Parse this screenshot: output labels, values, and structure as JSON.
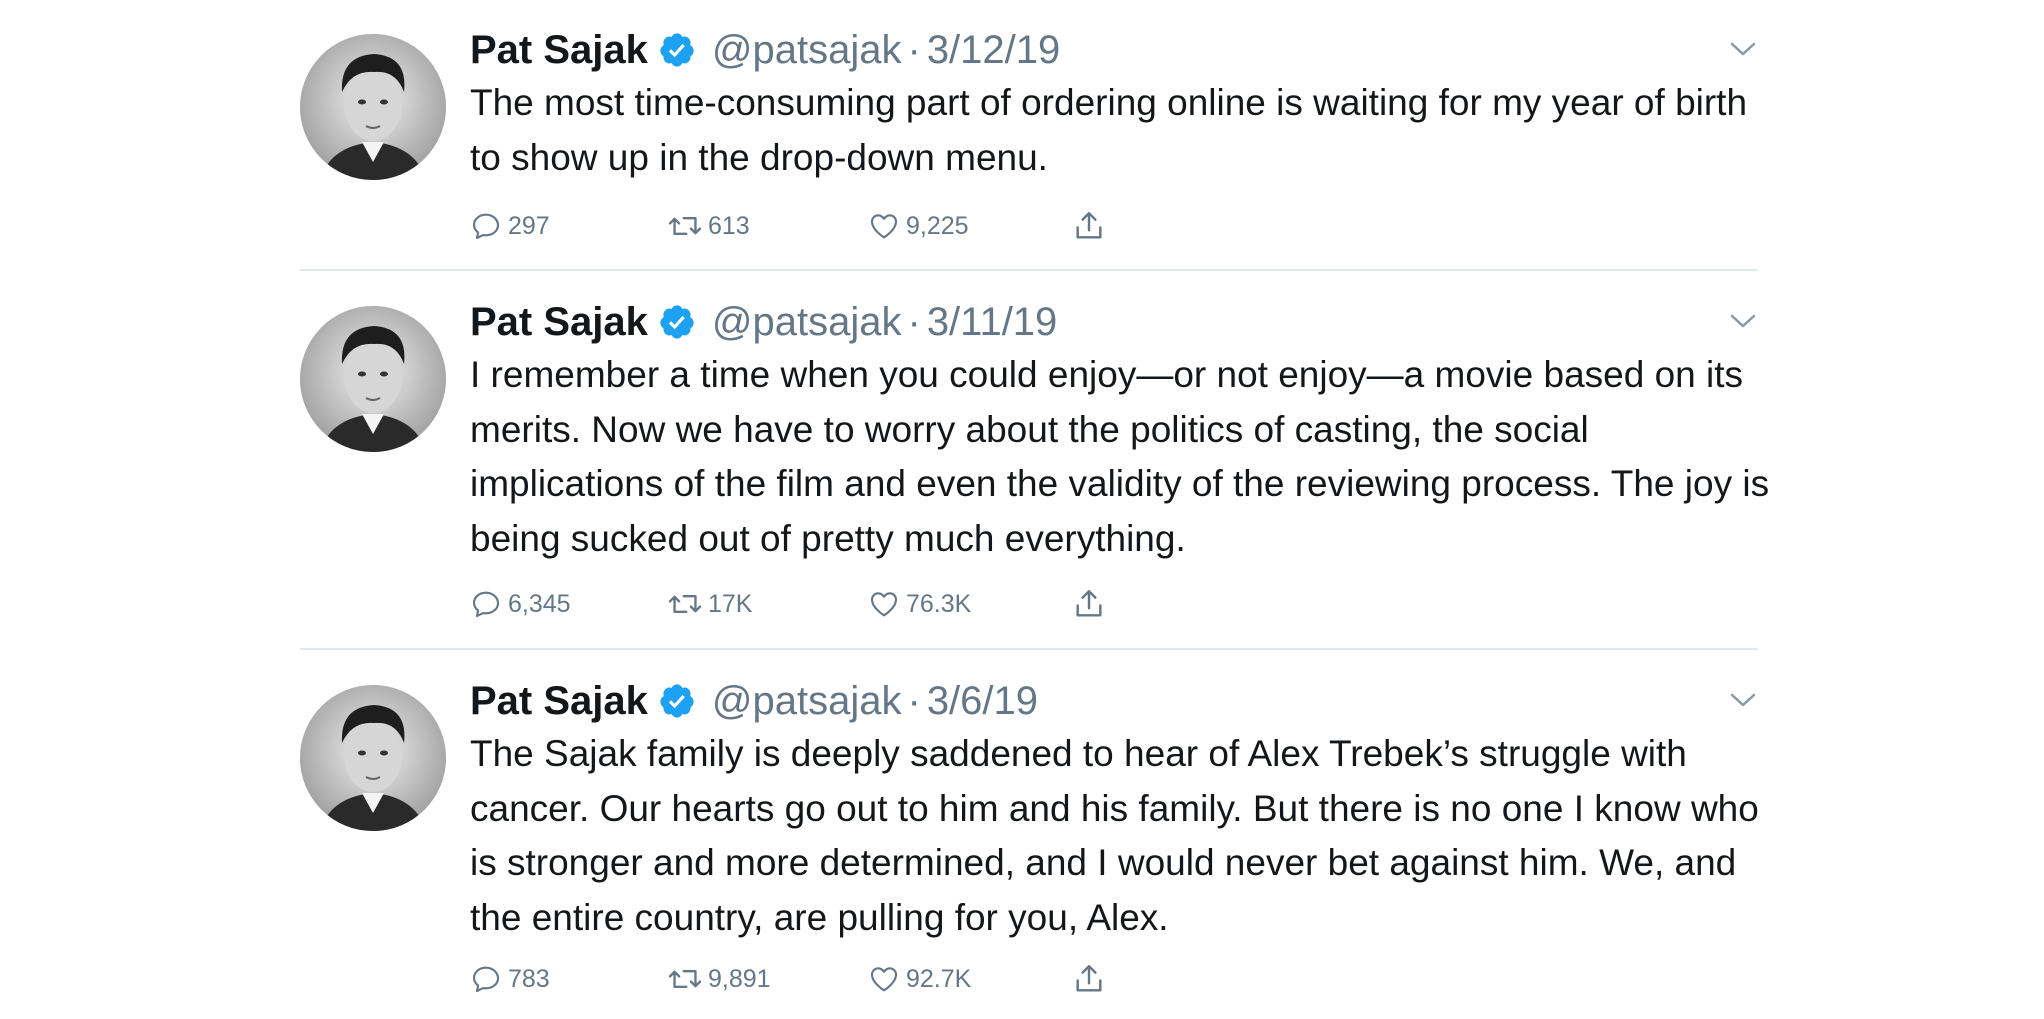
{
  "colors": {
    "text_primary": "#14171a",
    "text_secondary": "#657786",
    "verified_blue": "#1da1f2",
    "divider": "#e1e8ed"
  },
  "icons": {
    "verified": "verified-badge-icon",
    "caret": "chevron-down-icon",
    "reply": "reply-icon",
    "retweet": "retweet-icon",
    "like": "heart-icon",
    "share": "share-icon"
  },
  "tweets": [
    {
      "name": "Pat Sajak",
      "handle": "@patsajak",
      "separator": "·",
      "date": "3/12/19",
      "text": "The most time-consuming part of ordering online is waiting for my year of birth to show up in the drop-down menu.",
      "replies": "297",
      "retweets": "613",
      "likes": "9,225"
    },
    {
      "name": "Pat Sajak",
      "handle": "@patsajak",
      "separator": "·",
      "date": "3/11/19",
      "text": "I remember a time when you could enjoy—or not enjoy—a movie based on its merits. Now we have to worry about the politics of casting, the social implications of the film and even the validity of the reviewing process. The joy is being sucked out of pretty much everything.",
      "replies": "6,345",
      "retweets": "17K",
      "likes": "76.3K"
    },
    {
      "name": "Pat Sajak",
      "handle": "@patsajak",
      "separator": "·",
      "date": "3/6/19",
      "text": "The Sajak family is deeply saddened to hear of Alex Trebek’s struggle with cancer. Our hearts go out to him and his family. But there is no one I know who is stronger and more determined, and I would never bet against him. We, and the entire country, are pulling for you, Alex.",
      "replies": "783",
      "retweets": "9,891",
      "likes": "92.7K"
    }
  ]
}
